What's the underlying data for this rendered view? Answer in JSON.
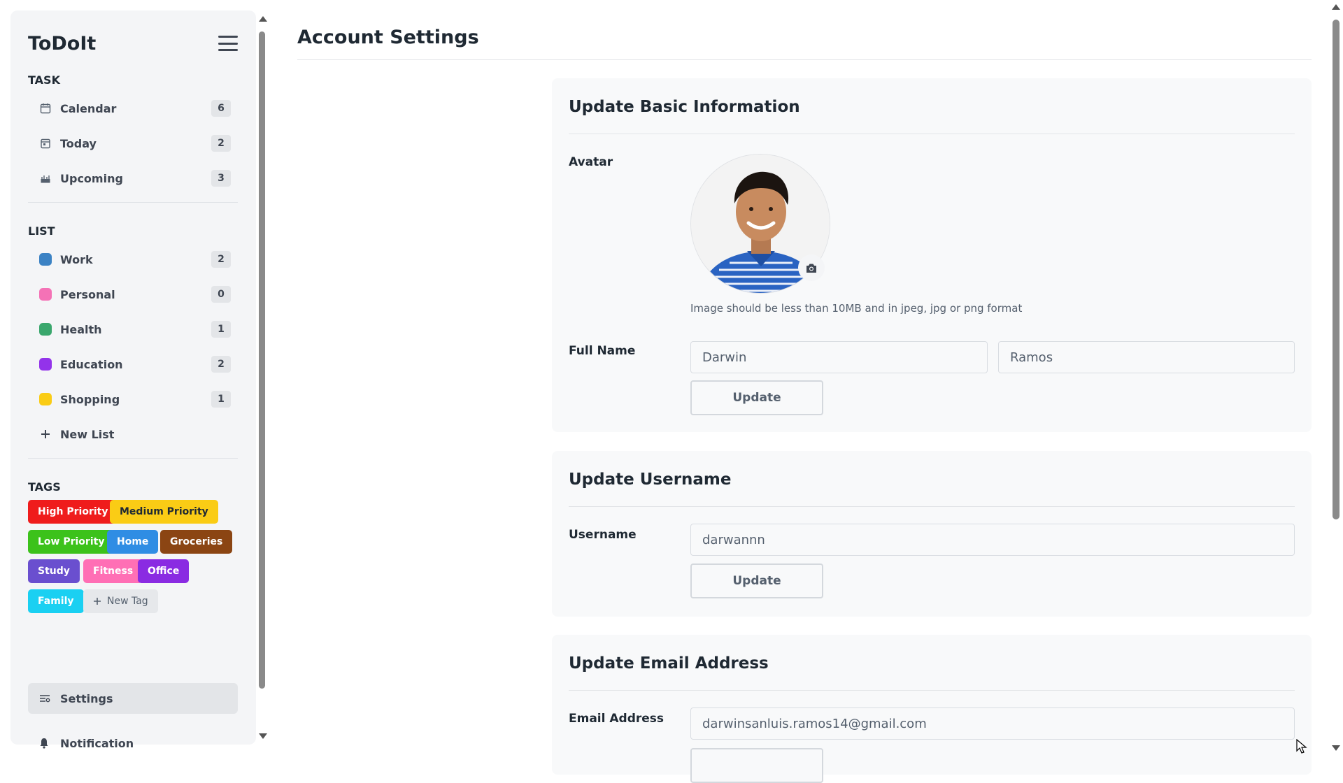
{
  "app": {
    "name": "ToDoIt"
  },
  "sidebar": {
    "task_section": "TASK",
    "tasks": [
      {
        "label": "Calendar",
        "count": "6",
        "icon": "calendar-icon"
      },
      {
        "label": "Today",
        "count": "2",
        "icon": "calendar-day-icon"
      },
      {
        "label": "Upcoming",
        "count": "3",
        "icon": "upcoming-icon"
      }
    ],
    "list_section": "LIST",
    "lists": [
      {
        "label": "Work",
        "count": "2",
        "color": "#3b82c4"
      },
      {
        "label": "Personal",
        "count": "0",
        "color": "#f472b6"
      },
      {
        "label": "Health",
        "count": "1",
        "color": "#3aa76d"
      },
      {
        "label": "Education",
        "count": "2",
        "color": "#9333ea"
      },
      {
        "label": "Shopping",
        "count": "1",
        "color": "#facc15"
      }
    ],
    "new_list_label": "New List",
    "tags_section": "TAGS",
    "tags": [
      {
        "label": "High Priority",
        "color": "#ef1c1c",
        "text_color": "#ffffff"
      },
      {
        "label": "Medium Priority",
        "color": "#facc15",
        "text_color": "#1f2933"
      },
      {
        "label": "Low Priority",
        "color": "#3cc21b",
        "text_color": "#ffffff"
      },
      {
        "label": "Home",
        "color": "#2f8de4",
        "text_color": "#ffffff"
      },
      {
        "label": "Groceries",
        "color": "#8b4513",
        "text_color": "#ffffff"
      },
      {
        "label": "Study",
        "color": "#6a4fcf",
        "text_color": "#ffffff"
      },
      {
        "label": "Fitness",
        "color": "#ff6fb5",
        "text_color": "#ffffff"
      },
      {
        "label": "Office",
        "color": "#8a2be2",
        "text_color": "#ffffff"
      },
      {
        "label": "Family",
        "color": "#1ad0f2",
        "text_color": "#ffffff"
      }
    ],
    "new_tag_label": "New Tag",
    "settings_label": "Settings",
    "notification_label": "Notification"
  },
  "main": {
    "title": "Account Settings",
    "basic_info": {
      "title": "Update Basic Information",
      "avatar_label": "Avatar",
      "avatar_hint": "Image should be less than 10MB and in jpeg, jpg or png format",
      "full_name_label": "Full Name",
      "first_name": "Darwin",
      "last_name": "Ramos",
      "update_label": "Update"
    },
    "username": {
      "title": "Update Username",
      "label": "Username",
      "value": "darwannn",
      "update_label": "Update"
    },
    "email": {
      "title": "Update Email Address",
      "label": "Email Address",
      "value": "darwinsanluis.ramos14@gmail.com"
    }
  }
}
